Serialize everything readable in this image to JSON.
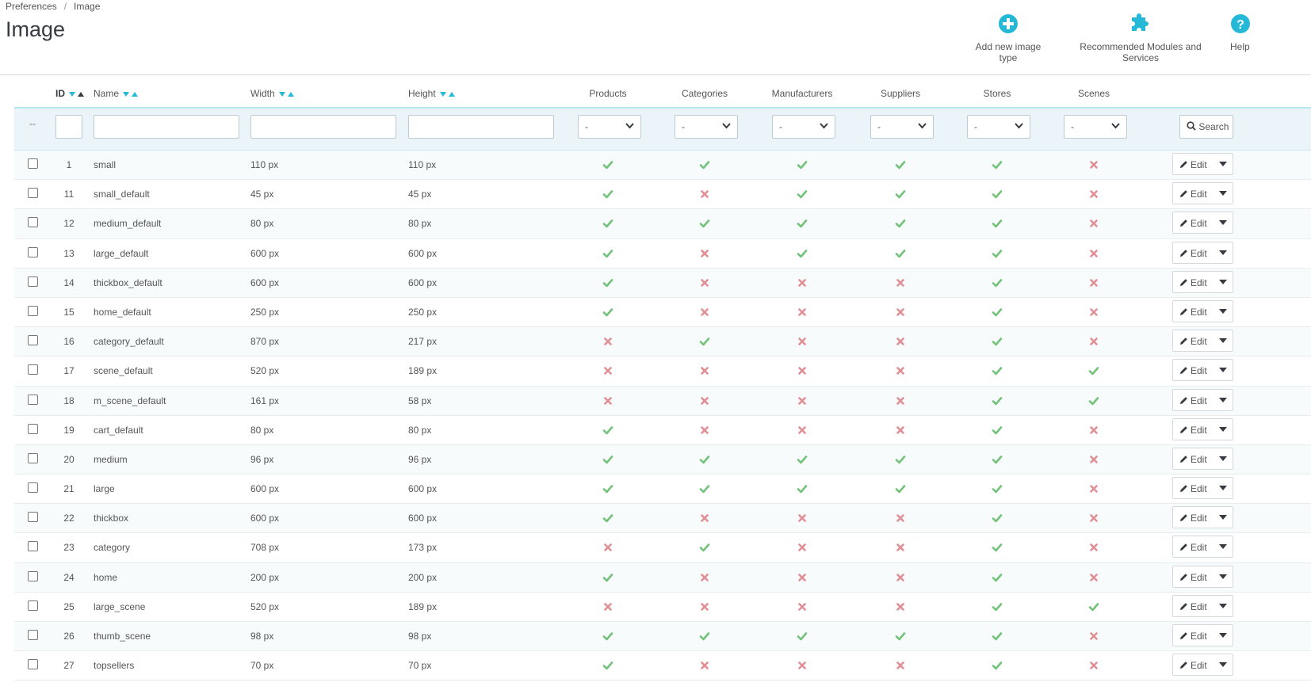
{
  "breadcrumb": {
    "parent": "Preferences",
    "separator": "/",
    "current": "Image"
  },
  "page_title": "Image",
  "toolbar": {
    "add_label": "Add new image type",
    "modules_label": "Recommended Modules and Services",
    "help_label": "Help"
  },
  "colors": {
    "accent": "#25b9d7",
    "check": "#72c279",
    "cross": "#e08f95"
  },
  "columns": {
    "id": "ID",
    "name": "Name",
    "width": "Width",
    "height": "Height",
    "products": "Products",
    "categories": "Categories",
    "manufacturers": "Manufacturers",
    "suppliers": "Suppliers",
    "stores": "Stores",
    "scenes": "Scenes"
  },
  "filters": {
    "dash": "--",
    "select_value": "-",
    "search_label": "Search"
  },
  "rows": [
    {
      "id": "1",
      "name": "small",
      "width": "110 px",
      "height": "110 px",
      "flags": [
        1,
        1,
        1,
        1,
        1,
        0
      ]
    },
    {
      "id": "11",
      "name": "small_default",
      "width": "45 px",
      "height": "45 px",
      "flags": [
        1,
        0,
        1,
        1,
        1,
        0
      ]
    },
    {
      "id": "12",
      "name": "medium_default",
      "width": "80 px",
      "height": "80 px",
      "flags": [
        1,
        1,
        1,
        1,
        1,
        0
      ]
    },
    {
      "id": "13",
      "name": "large_default",
      "width": "600 px",
      "height": "600 px",
      "flags": [
        1,
        0,
        1,
        1,
        1,
        0
      ]
    },
    {
      "id": "14",
      "name": "thickbox_default",
      "width": "600 px",
      "height": "600 px",
      "flags": [
        1,
        0,
        0,
        0,
        1,
        0
      ]
    },
    {
      "id": "15",
      "name": "home_default",
      "width": "250 px",
      "height": "250 px",
      "flags": [
        1,
        0,
        0,
        0,
        1,
        0
      ]
    },
    {
      "id": "16",
      "name": "category_default",
      "width": "870 px",
      "height": "217 px",
      "flags": [
        0,
        1,
        0,
        0,
        1,
        0
      ]
    },
    {
      "id": "17",
      "name": "scene_default",
      "width": "520 px",
      "height": "189 px",
      "flags": [
        0,
        0,
        0,
        0,
        1,
        1
      ]
    },
    {
      "id": "18",
      "name": "m_scene_default",
      "width": "161 px",
      "height": "58 px",
      "flags": [
        0,
        0,
        0,
        0,
        1,
        1
      ]
    },
    {
      "id": "19",
      "name": "cart_default",
      "width": "80 px",
      "height": "80 px",
      "flags": [
        1,
        0,
        0,
        0,
        1,
        0
      ]
    },
    {
      "id": "20",
      "name": "medium",
      "width": "96 px",
      "height": "96 px",
      "flags": [
        1,
        1,
        1,
        1,
        1,
        0
      ]
    },
    {
      "id": "21",
      "name": "large",
      "width": "600 px",
      "height": "600 px",
      "flags": [
        1,
        1,
        1,
        1,
        1,
        0
      ]
    },
    {
      "id": "22",
      "name": "thickbox",
      "width": "600 px",
      "height": "600 px",
      "flags": [
        1,
        0,
        0,
        0,
        1,
        0
      ]
    },
    {
      "id": "23",
      "name": "category",
      "width": "708 px",
      "height": "173 px",
      "flags": [
        0,
        1,
        0,
        0,
        1,
        0
      ]
    },
    {
      "id": "24",
      "name": "home",
      "width": "200 px",
      "height": "200 px",
      "flags": [
        1,
        0,
        0,
        0,
        1,
        0
      ]
    },
    {
      "id": "25",
      "name": "large_scene",
      "width": "520 px",
      "height": "189 px",
      "flags": [
        0,
        0,
        0,
        0,
        1,
        1
      ]
    },
    {
      "id": "26",
      "name": "thumb_scene",
      "width": "98 px",
      "height": "98 px",
      "flags": [
        1,
        1,
        1,
        1,
        1,
        0
      ]
    },
    {
      "id": "27",
      "name": "topsellers",
      "width": "70 px",
      "height": "70 px",
      "flags": [
        1,
        0,
        0,
        0,
        1,
        0
      ]
    }
  ],
  "row_action": {
    "edit_label": "Edit"
  }
}
